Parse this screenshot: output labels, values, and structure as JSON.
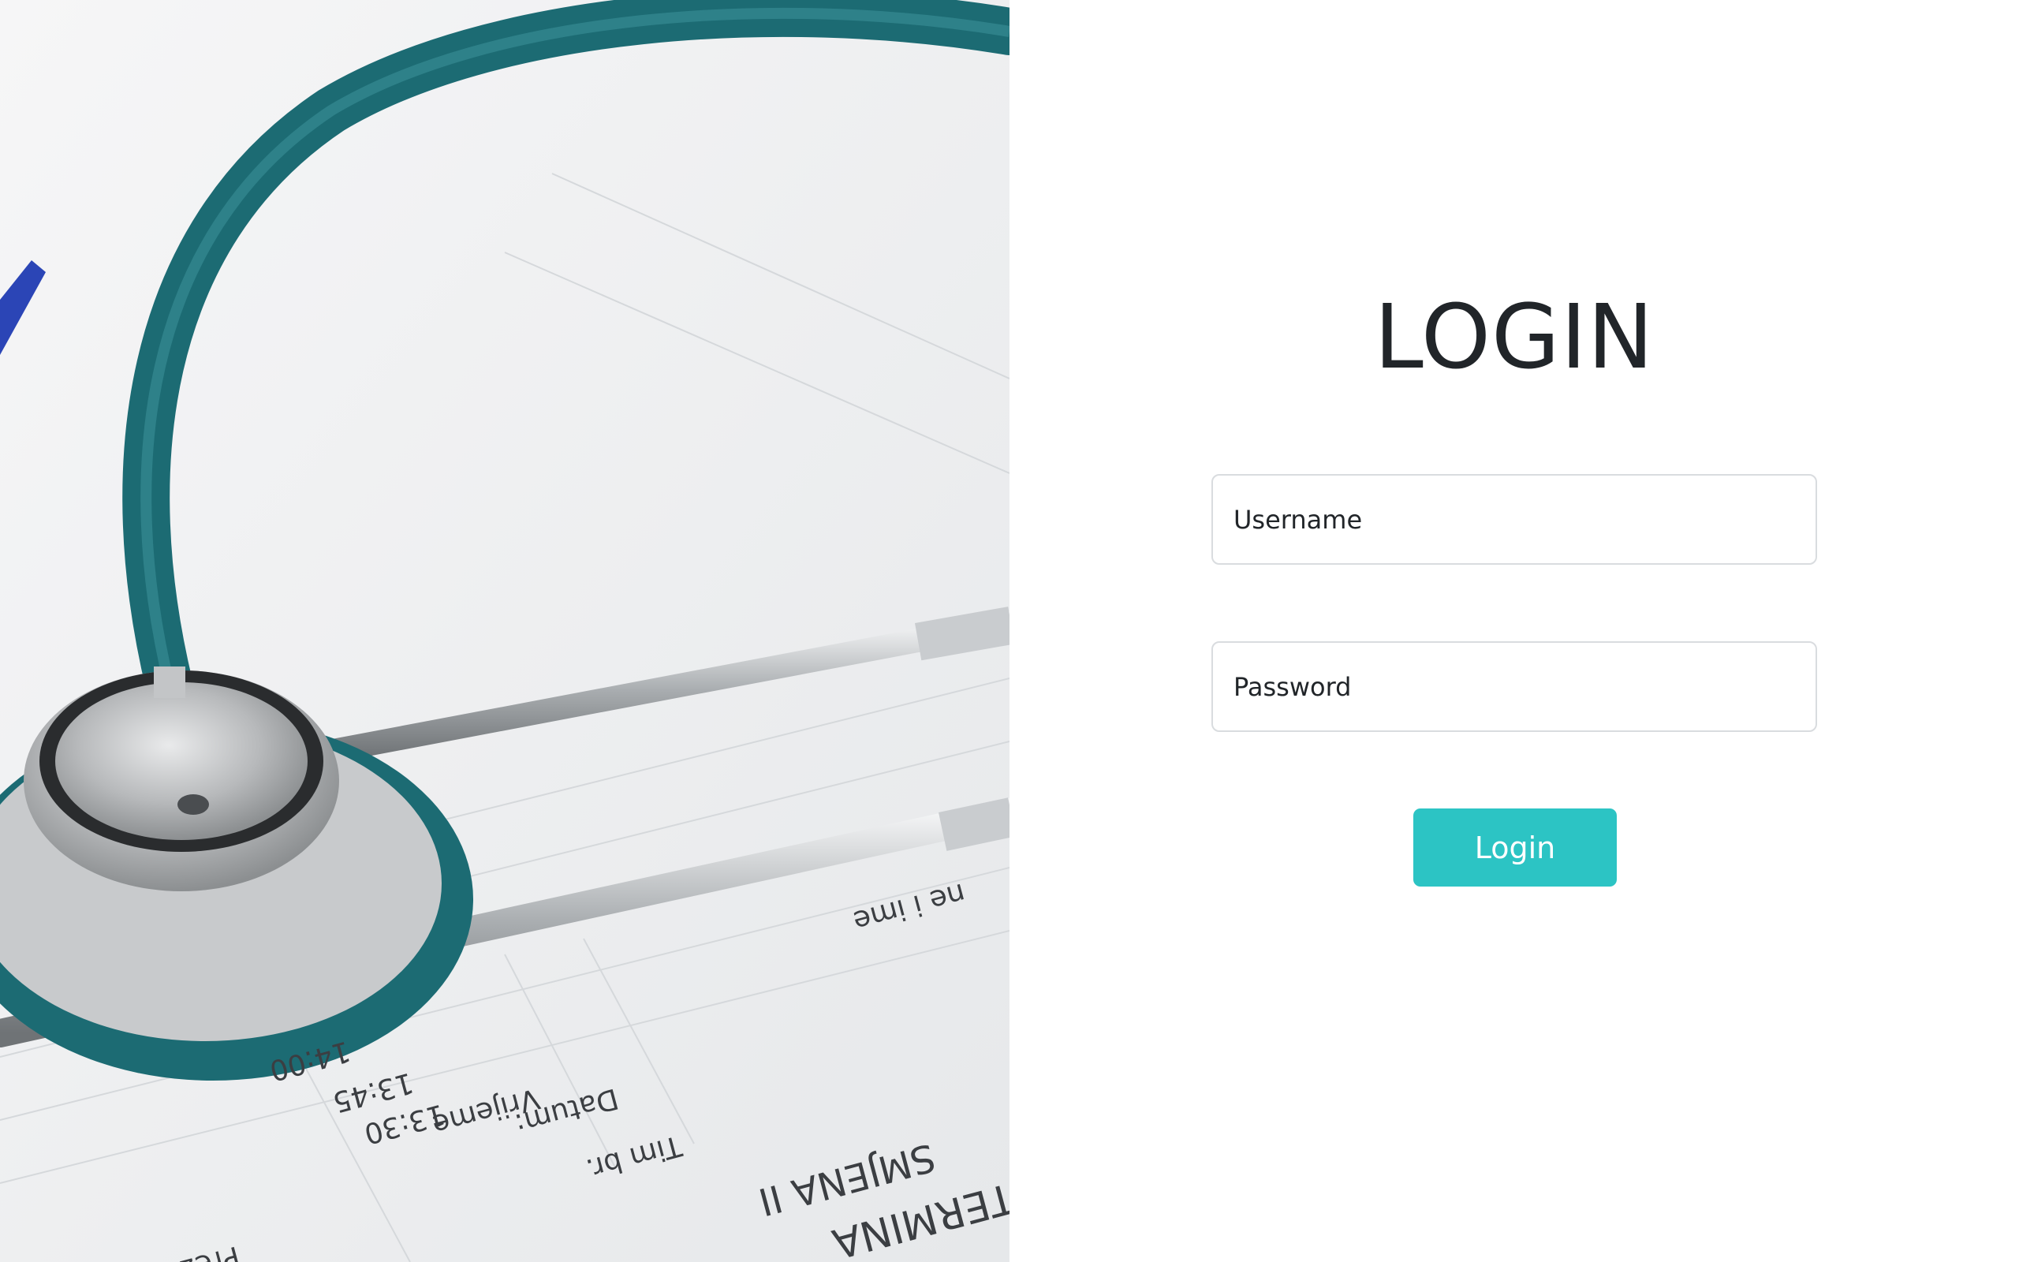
{
  "login": {
    "title": "LOGIN",
    "username_placeholder": "Username",
    "password_placeholder": "Password",
    "button_label": "Login"
  },
  "hero_image": {
    "description_icon": "stethoscope-icon",
    "printed_text": [
      "14:00",
      "13:45",
      "13:30",
      "Vrijeme",
      "Datum:",
      "Tim br.",
      "SMJENA II",
      "TERMINA",
      "ne i ime",
      "Prezid"
    ]
  },
  "colors": {
    "accent": "#2cc4c4",
    "title": "#212529",
    "field_border": "#d9dcdf",
    "tube": "#1c6b73"
  }
}
